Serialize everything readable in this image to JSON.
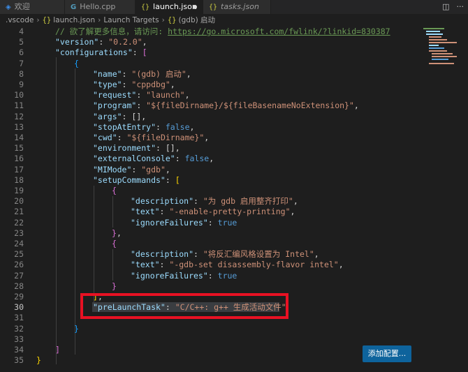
{
  "tabs": [
    {
      "label": "欢迎",
      "icon": "vscode-welcome-icon"
    },
    {
      "label": "Hello.cpp",
      "icon": "cpp-file-icon"
    },
    {
      "label": "launch.json",
      "icon": "json-file-icon",
      "active": true,
      "modified": true
    },
    {
      "label": "tasks.json",
      "icon": "json-file-icon",
      "italic": true
    }
  ],
  "toolbar": {
    "split_icon": "split-editor-icon",
    "more_icon": "more-actions-icon"
  },
  "breadcrumb": [
    ".vscode",
    "launch.json",
    "Launch Targets",
    "(gdb) 启动"
  ],
  "editor": {
    "current_line": 30,
    "lines": [
      {
        "n": "4"
      },
      {
        "n": "5"
      },
      {
        "n": "6"
      },
      {
        "n": "7"
      },
      {
        "n": "8"
      },
      {
        "n": "9"
      },
      {
        "n": "10"
      },
      {
        "n": "11"
      },
      {
        "n": "12"
      },
      {
        "n": "13"
      },
      {
        "n": "14"
      },
      {
        "n": "15"
      },
      {
        "n": "16"
      },
      {
        "n": "17"
      },
      {
        "n": "18"
      },
      {
        "n": "19"
      },
      {
        "n": "20"
      },
      {
        "n": "21"
      },
      {
        "n": "22"
      },
      {
        "n": "23"
      },
      {
        "n": "24"
      },
      {
        "n": "25"
      },
      {
        "n": "26"
      },
      {
        "n": "27"
      },
      {
        "n": "28"
      },
      {
        "n": "29"
      },
      {
        "n": "30"
      },
      {
        "n": "31"
      },
      {
        "n": "32"
      },
      {
        "n": "33"
      },
      {
        "n": "34"
      },
      {
        "n": "35"
      }
    ],
    "code": {
      "l4_comment": "// 欲了解更多信息，请访问: ",
      "l4_link": "https://go.microsoft.com/fwlink/?linkid=830387",
      "version_key": "\"version\"",
      "version_val": "\"0.2.0\"",
      "configurations_key": "\"configurations\"",
      "name_key": "\"name\"",
      "name_val": "\"(gdb) 启动\"",
      "type_key": "\"type\"",
      "type_val": "\"cppdbg\"",
      "request_key": "\"request\"",
      "request_val": "\"launch\"",
      "program_key": "\"program\"",
      "program_val": "\"${fileDirname}/${fileBasenameNoExtension}\"",
      "args_key": "\"args\"",
      "args_val": "[]",
      "stopAtEntry_key": "\"stopAtEntry\"",
      "stopAtEntry_val": "false",
      "cwd_key": "\"cwd\"",
      "cwd_val": "\"${fileDirname}\"",
      "environment_key": "\"environment\"",
      "environment_val": "[]",
      "externalConsole_key": "\"externalConsole\"",
      "externalConsole_val": "false",
      "MIMode_key": "\"MIMode\"",
      "MIMode_val": "\"gdb\"",
      "setupCommands_key": "\"setupCommands\"",
      "desc1_key": "\"description\"",
      "desc1_val": "\"为 gdb 启用整齐打印\"",
      "text1_key": "\"text\"",
      "text1_val": "\"-enable-pretty-printing\"",
      "ignore1_key": "\"ignoreFailures\"",
      "ignore1_val": "true",
      "desc2_key": "\"description\"",
      "desc2_val": "\"将反汇编风格设置为 Intel\"",
      "text2_key": "\"text\"",
      "text2_val": "\"-gdb-set disassembly-flavor intel\"",
      "ignore2_key": "\"ignoreFailures\"",
      "ignore2_val": "true",
      "preLaunch_key": "\"preLaunchTask\"",
      "preLaunch_val": "\"C/C++: g++ 生成活动文件\""
    }
  },
  "add_config_button": "添加配置...",
  "colors": {
    "highlight_border": "#e81123",
    "button_bg": "#0e639c"
  }
}
